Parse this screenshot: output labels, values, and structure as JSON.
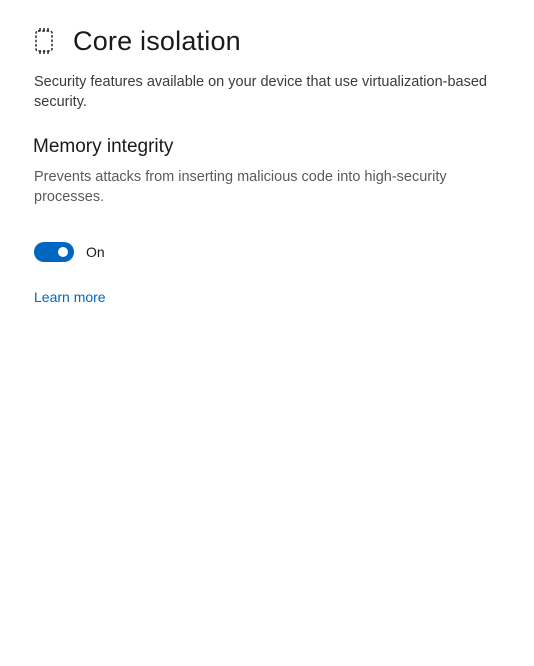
{
  "page": {
    "title": "Core isolation",
    "title_icon": "core-isolation-icon",
    "description": "Security features available on your device that use virtualization-based security."
  },
  "memory_integrity": {
    "title": "Memory integrity",
    "description": "Prevents attacks from inserting malicious code into high-security processes.",
    "toggle_on": true,
    "toggle_state_label": "On"
  },
  "links": {
    "learn_more": "Learn more"
  },
  "colors": {
    "accent": "#0067c0",
    "background": "#ffffff",
    "text_primary": "#1a1a1a",
    "text_secondary": "#5a5a5a"
  }
}
